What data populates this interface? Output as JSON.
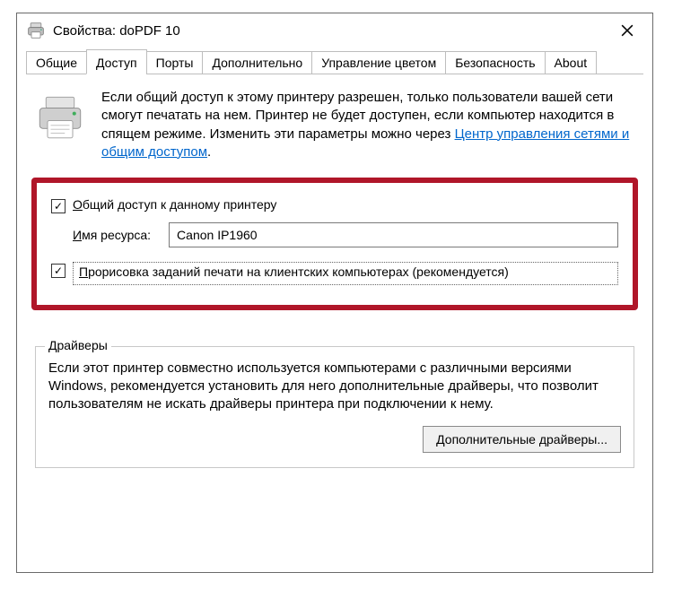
{
  "window": {
    "title": "Свойства: doPDF 10"
  },
  "tabs": {
    "general": "Общие",
    "sharing": "Доступ",
    "ports": "Порты",
    "advanced": "Дополнительно",
    "color_mgmt": "Управление цветом",
    "security": "Безопасность",
    "about": "About"
  },
  "info": {
    "text_before_link": "Если общий доступ к этому принтеру разрешен, только пользователи вашей сети смогут печатать на нем. Принтер не будет доступен, если компьютер находится в спящем режиме. Изменить эти параметры можно через ",
    "link_text": "Центр управления сетями и общим доступом",
    "text_after_link": "."
  },
  "share": {
    "checkbox_prefix": "О",
    "checkbox_rest": "бщий доступ к данному принтеру",
    "resource_prefix": "И",
    "resource_rest": "мя ресурса:",
    "resource_value": "Canon IP1960",
    "render_prefix": "П",
    "render_rest": "рорисовка заданий печати на клиентских компьютерах (рекомендуется)"
  },
  "drivers": {
    "group_title": "Драйверы",
    "text": "Если этот принтер совместно используется компьютерами с различными версиями Windows, рекомендуется установить для него дополнительные драйверы, что позволит пользователям не искать драйверы принтера при подключении к нему.",
    "button": "Дополнительные драйверы..."
  },
  "icons": {
    "printer": "printer-icon",
    "close": "close-icon"
  }
}
